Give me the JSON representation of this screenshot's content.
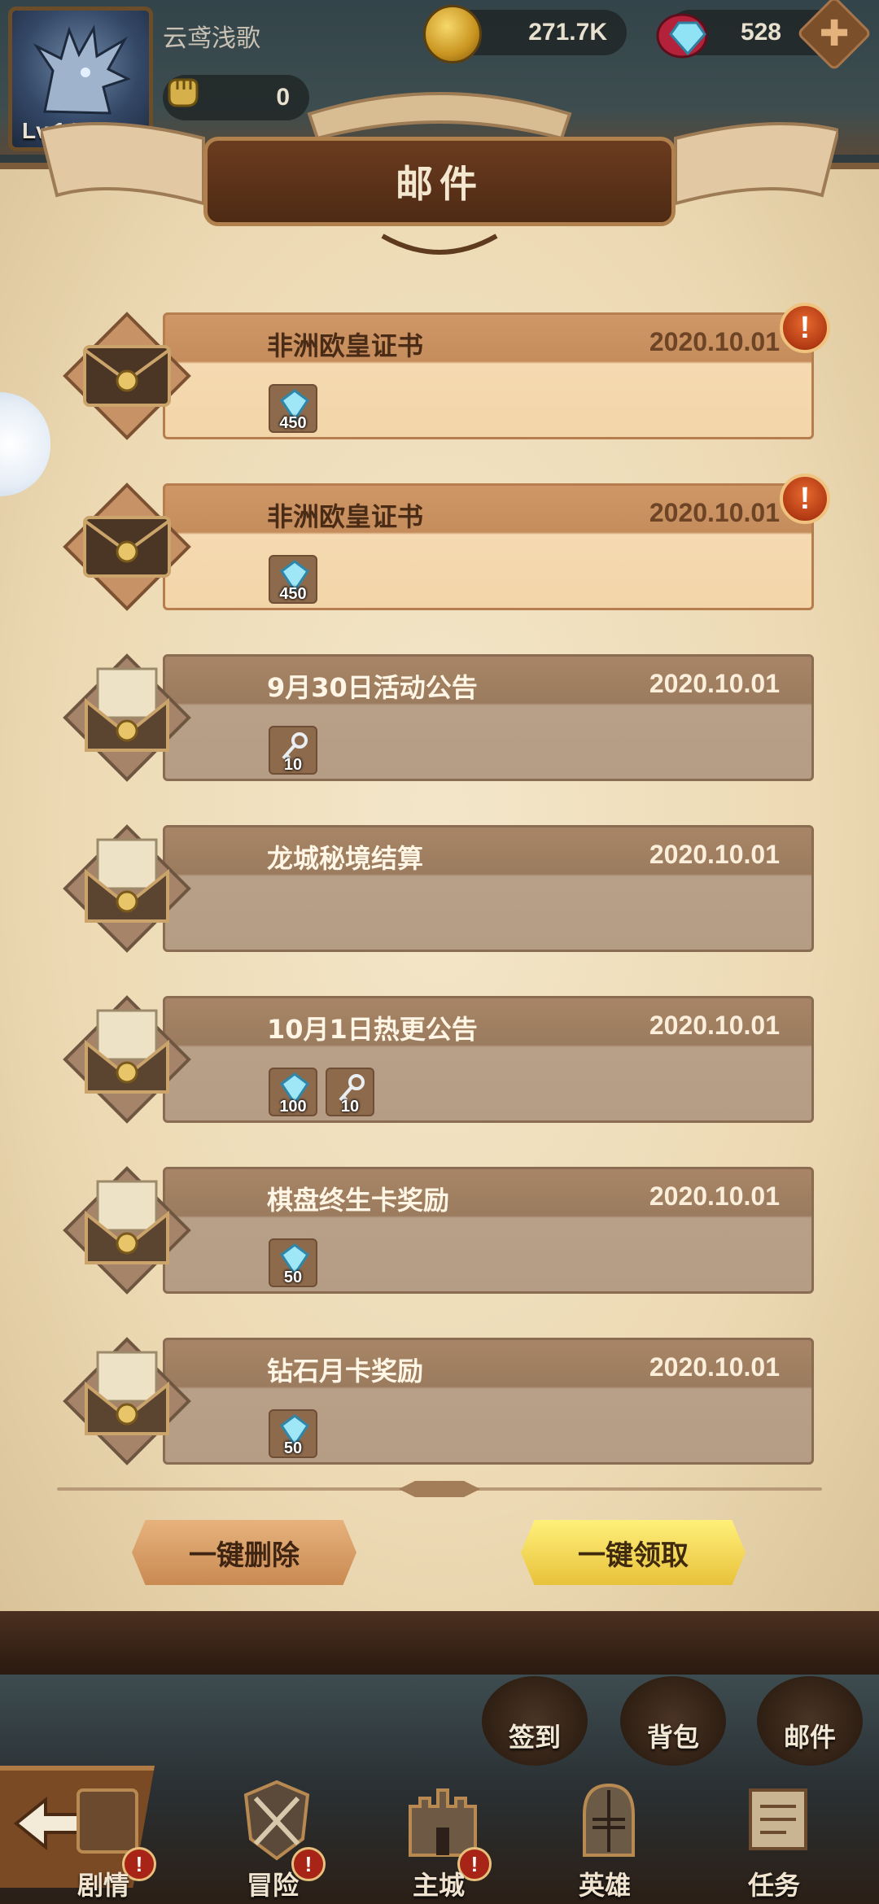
{
  "player": {
    "name": "云鸢浅歌",
    "level": "Lv.142",
    "power": "0"
  },
  "resources": {
    "gold": "271.7K",
    "gems": "528",
    "plus_label": "✚"
  },
  "panel": {
    "title": "邮件"
  },
  "mails": [
    {
      "title": "非洲欧皇证书",
      "date": "2020.10.01",
      "unread": true,
      "alert": "!",
      "items": [
        {
          "icon": "diamond-icon",
          "count": "450"
        }
      ]
    },
    {
      "title": "非洲欧皇证书",
      "date": "2020.10.01",
      "unread": true,
      "alert": "!",
      "items": [
        {
          "icon": "diamond-icon",
          "count": "450"
        }
      ]
    },
    {
      "title": "9月30日活动公告",
      "date": "2020.10.01",
      "unread": false,
      "items": [
        {
          "icon": "key-icon",
          "count": "10"
        }
      ]
    },
    {
      "title": "龙城秘境结算",
      "date": "2020.10.01",
      "unread": false,
      "items": []
    },
    {
      "title": "10月1日热更公告",
      "date": "2020.10.01",
      "unread": false,
      "items": [
        {
          "icon": "diamond-icon",
          "count": "100"
        },
        {
          "icon": "key-icon",
          "count": "10"
        }
      ]
    },
    {
      "title": "棋盘终生卡奖励",
      "date": "2020.10.01",
      "unread": false,
      "items": [
        {
          "icon": "diamond-icon",
          "count": "50"
        }
      ]
    },
    {
      "title": "钻石月卡奖励",
      "date": "2020.10.01",
      "unread": false,
      "items": [
        {
          "icon": "diamond-icon",
          "count": "50"
        }
      ]
    }
  ],
  "actions": {
    "delete_all": "一键删除",
    "claim_all": "一键领取"
  },
  "quick_links": [
    {
      "label": "签到"
    },
    {
      "label": "背包"
    },
    {
      "label": "邮件"
    }
  ],
  "nav": [
    {
      "label": "剧情",
      "badge": "!"
    },
    {
      "label": "冒险",
      "badge": "!"
    },
    {
      "label": "主城",
      "badge": "!"
    },
    {
      "label": "英雄"
    },
    {
      "label": "任务"
    }
  ]
}
